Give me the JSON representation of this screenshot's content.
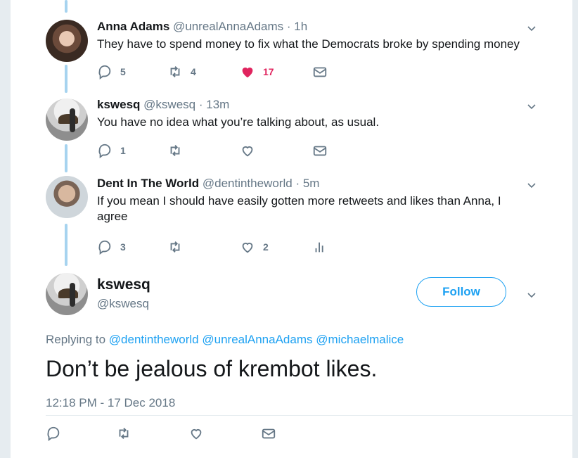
{
  "tweets": [
    {
      "name": "Anna Adams",
      "handle": "@unrealAnnaAdams",
      "time": "· 1h",
      "text": "They have to spend money to fix what the Democrats broke by spending money",
      "replies": "5",
      "retweets": "4",
      "likes": "17"
    },
    {
      "name": "kswesq",
      "handle": "@kswesq",
      "time": "· 13m",
      "text": "You have no idea what you’re talking about, as usual.",
      "replies": "1",
      "retweets": "",
      "likes": ""
    },
    {
      "name": "Dent In The World",
      "handle": "@dentintheworld",
      "time": "· 5m",
      "text": "If you mean I should have easily gotten more retweets and likes than Anna, I agree",
      "replies": "3",
      "retweets": "",
      "likes": "2"
    }
  ],
  "focus": {
    "name": "kswesq",
    "handle": "@kswesq",
    "follow_label": "Follow",
    "replying_prefix": "Replying to",
    "mentions": [
      "@dentintheworld",
      "@unrealAnnaAdams",
      "@michaelmalice"
    ],
    "text": "Don’t be jealous of krembot likes.",
    "timestamp": "12:18 PM - 17 Dec 2018"
  },
  "icons": {
    "reply": "reply-icon",
    "retweet": "retweet-icon",
    "like": "heart-icon",
    "dm": "envelope-icon",
    "analytics": "analytics-icon",
    "more": "chevron-down-icon"
  },
  "colors": {
    "accent": "#1da1f2",
    "like": "#e0245e",
    "muted": "#657786",
    "thread": "#a6d3ef"
  }
}
